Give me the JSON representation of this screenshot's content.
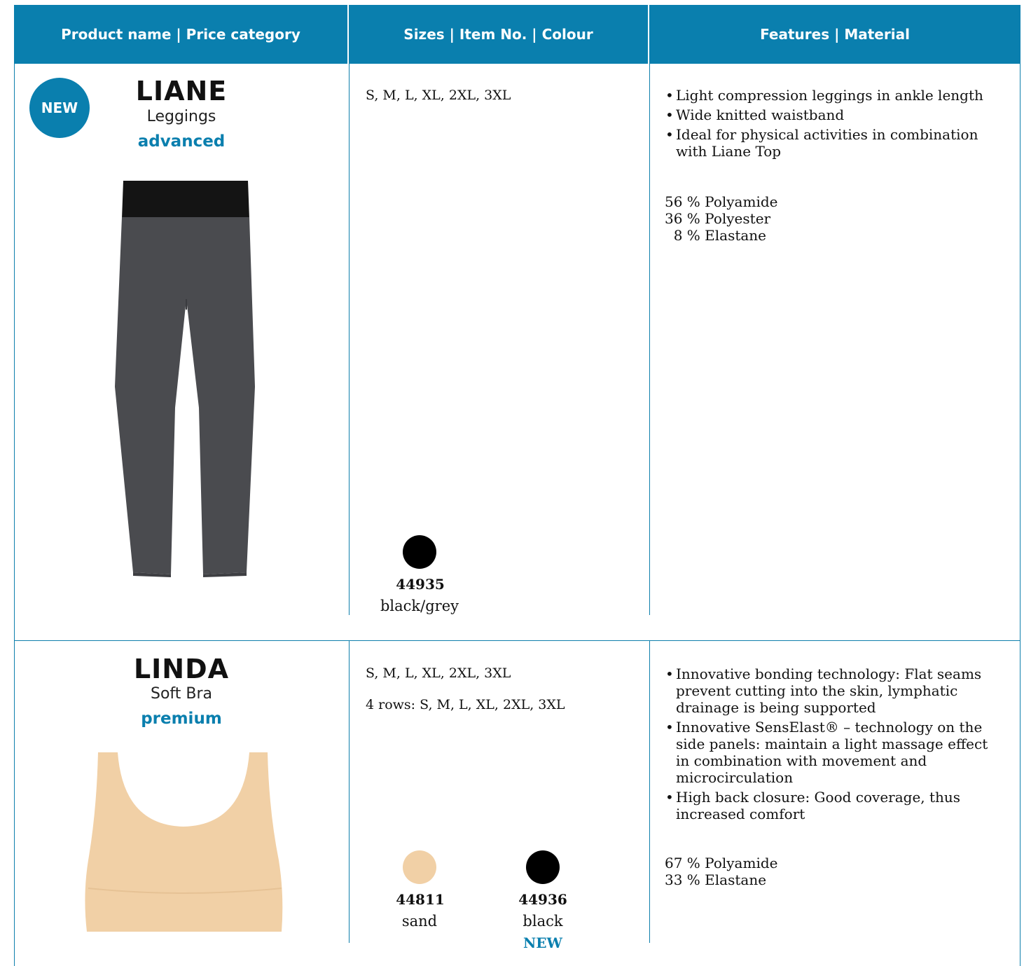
{
  "header": {
    "col1": "Product name | Price category",
    "col2": "Sizes  | Item No. | Colour",
    "col3": "Features | Material"
  },
  "products": [
    {
      "badge": "NEW",
      "name": "LIANE",
      "type": "Leggings",
      "category": "advanced",
      "sizes": "S, M, L, XL, 2XL, 3XL",
      "colours": [
        {
          "item_no": "44935",
          "name": "black/grey",
          "hex": "#000000"
        }
      ],
      "features": [
        "Light compression leggings in ankle length",
        "Wide knitted waistband",
        "Ideal for physical activities in combination with Liane Top"
      ],
      "material": [
        "56 % Polyamide",
        "36 % Polyester",
        "  8 % Elastane"
      ]
    },
    {
      "name": "LINDA",
      "type": "Soft Bra",
      "category": "premium",
      "sizes": "S, M, L, XL, 2XL, 3XL",
      "sizes_rows": "4 rows: S, M, L, XL, 2XL, 3XL",
      "colours": [
        {
          "item_no": "44811",
          "name": "sand",
          "hex": "#f1d0a6"
        },
        {
          "item_no": "44936",
          "name": "black",
          "hex": "#000000",
          "tag": "NEW"
        }
      ],
      "features": [
        "Innovative bonding technology: Flat seams prevent cutting into the skin, lymphatic drainage is being supported",
        "Innovative SensElast® – technology on the side panels: maintain a light massage effect in combination with movement and microcirculation",
        "High back closure: Good coverage, thus increased comfort"
      ],
      "material": [
        "67 % Polyamide",
        "33 % Elastane"
      ]
    }
  ],
  "colors": {
    "accent": "#0a7fae",
    "leggings_body": "#4a4b4f",
    "leggings_band": "#141414",
    "bra": "#f1d0a6"
  }
}
